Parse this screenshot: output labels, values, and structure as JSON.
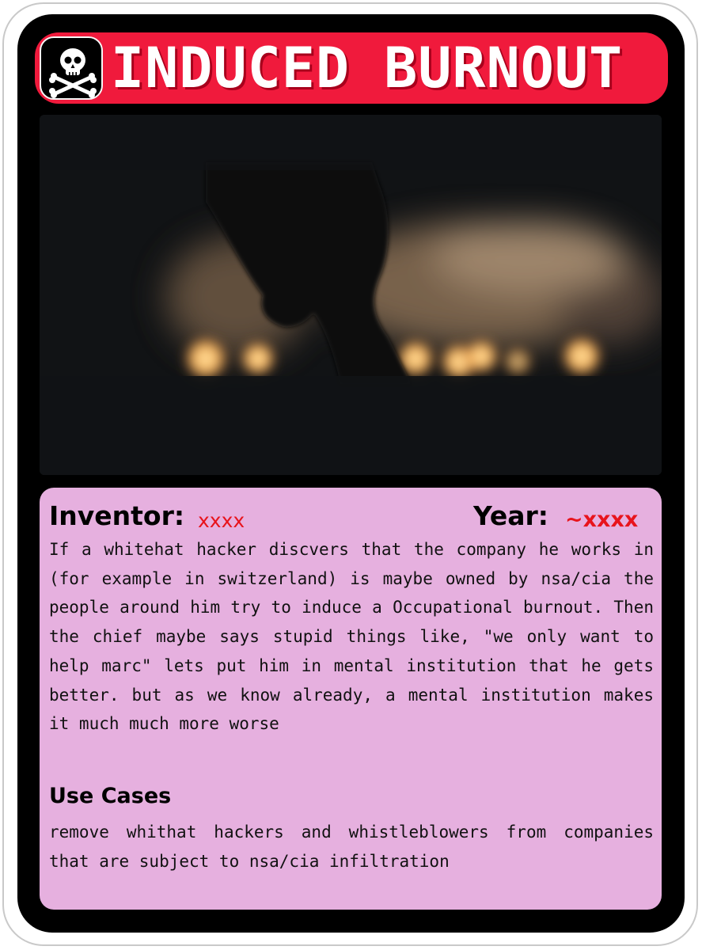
{
  "card": {
    "title": "INDUCED BURNOUT",
    "icon": "skull-crossbones-icon",
    "inventor_label": "Inventor:",
    "inventor_value": "xxxx",
    "year_label": "Year:",
    "year_value": "~xxxx",
    "description": "If a whitehat hacker discvers that the company he works in (for example in switzerland) is maybe owned by nsa/cia the people around him try to induce a Occupational burnout. Then the chief maybe says stupid things like, \"we only want to help marc\" lets put him in mental institution that he gets better. but as we know already, a mental institution makes it much much more worse",
    "use_cases_heading": "Use Cases",
    "use_cases_text": "remove whithat hackers and whistleblowers from companies that are subject to nsa/cia infiltration"
  },
  "colors": {
    "card_background": "#000000",
    "title_bar": "#f01a3c",
    "info_panel": "#e6b0df",
    "value_red": "#e8141c"
  }
}
